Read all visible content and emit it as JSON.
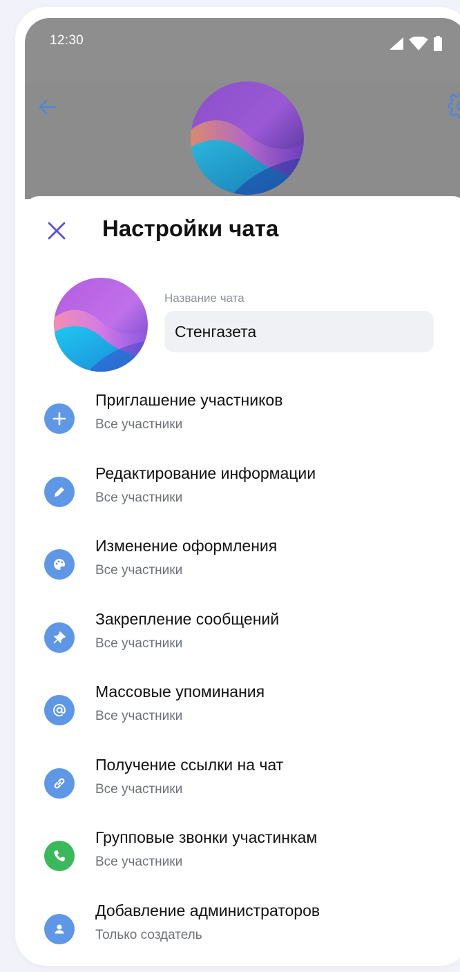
{
  "status_bar": {
    "time": "12:30"
  },
  "header": {
    "back_icon": "arrow-left-icon",
    "settings_icon": "gear-icon"
  },
  "sheet": {
    "title": "Настройки чата",
    "chat_name_label": "Название чата",
    "chat_name_value": "Стенгазета"
  },
  "settings": [
    {
      "title": "Приглашение участников",
      "value": "Все участники",
      "icon": "plus-icon",
      "color": "#5e97e6"
    },
    {
      "title": "Редактирование информации",
      "value": "Все участники",
      "icon": "pencil-icon",
      "color": "#5e97e6"
    },
    {
      "title": "Изменение оформления",
      "value": "Все участники",
      "icon": "palette-icon",
      "color": "#5e97e6"
    },
    {
      "title": "Закрепление сообщений",
      "value": "Все участники",
      "icon": "pin-icon",
      "color": "#5e97e6"
    },
    {
      "title": "Массовые упоминания",
      "value": "Все участники",
      "icon": "at-icon",
      "color": "#5e97e6"
    },
    {
      "title": "Получение ссылки на чат",
      "value": "Все участники",
      "icon": "link-icon",
      "color": "#5e97e6"
    },
    {
      "title": "Групповые звонки участинкам",
      "value": "Все участники",
      "icon": "phone-icon",
      "color": "#3ab85a"
    },
    {
      "title": "Добавление администраторов",
      "value": "Только создатель",
      "icon": "user-icon",
      "color": "#5e97e6"
    }
  ],
  "colors": {
    "accent": "#5e97e6",
    "close": "#5b4fd6",
    "call": "#3ab85a"
  }
}
